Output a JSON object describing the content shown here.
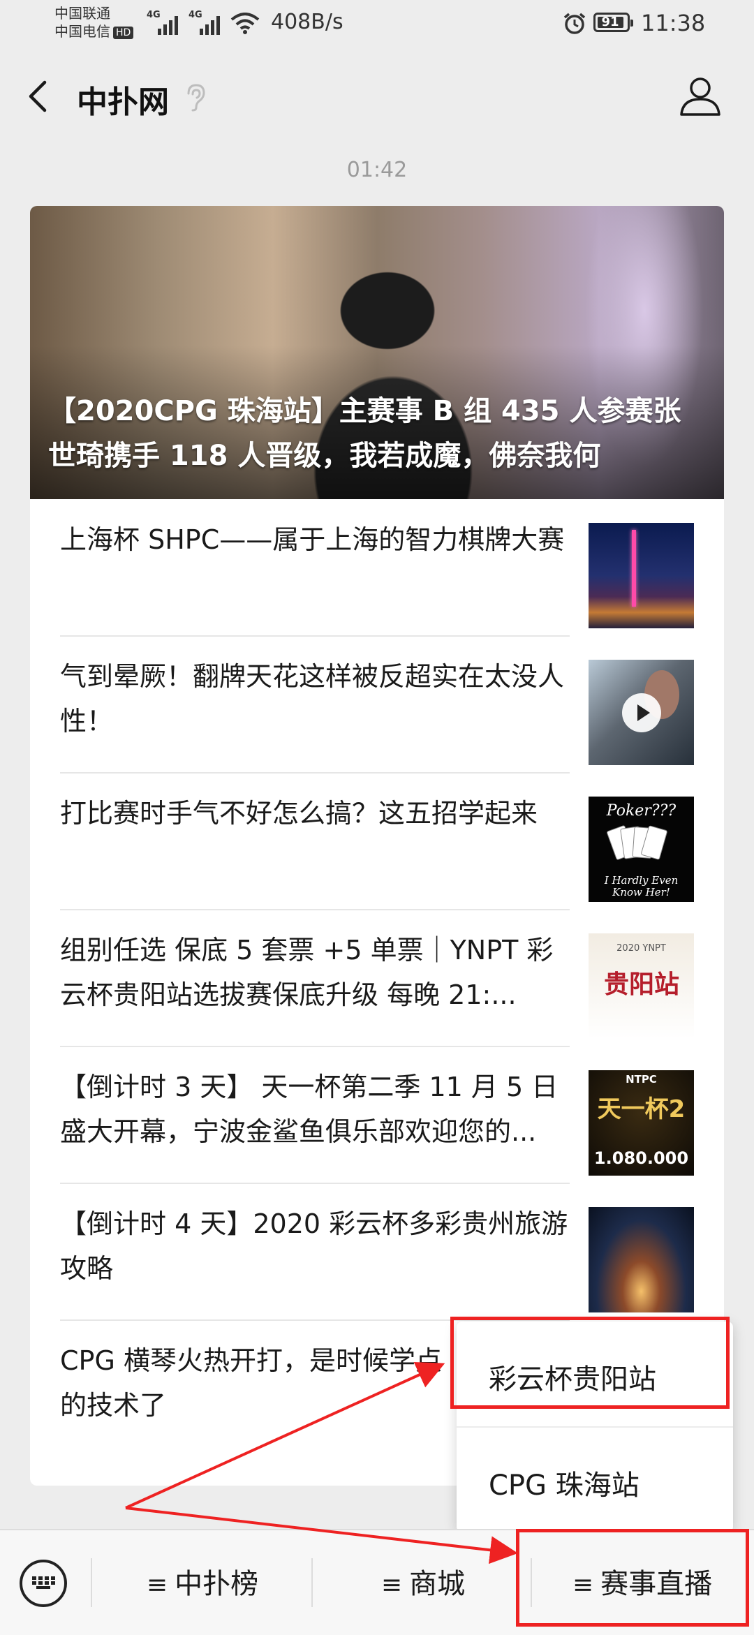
{
  "status_bar": {
    "carrier_1": "中国联通",
    "carrier_2": "中国电信",
    "hd_badge": "HD",
    "net_1": "4G",
    "net_2": "4G",
    "net_speed": "408B/s",
    "battery": "91",
    "time": "11:38"
  },
  "header": {
    "title": "中扑网",
    "icons": {
      "back": "back-arrow-icon",
      "listen": "ear-icon",
      "profile": "person-icon"
    }
  },
  "message_time": "01:42",
  "hero": {
    "title": "【2020CPG 珠海站】主赛事 B 组 435 人参赛张世琦携手 118 人晋级，我若成魔，佛奈我何"
  },
  "articles": [
    {
      "title": "上海杯 SHPC——属于上海的智力棋牌大赛",
      "thumb": "shanghai-night-skyline"
    },
    {
      "title": "气到晕厥！翻牌天花这样被反超实在太没人性！",
      "thumb": "poker-video",
      "has_video": true
    },
    {
      "title": "打比赛时手气不好怎么搞？这五招学起来",
      "thumb": "poker-cards",
      "thumb_text_top": "Poker???",
      "thumb_text_bottom": "I Hardly Even Know Her!"
    },
    {
      "title": "组别任选 保底 5 套票 +5 单票｜YNPT 彩云杯贵阳站选拔赛保底升级 每晚 21:...",
      "thumb": "ynpt-guiyang-poster",
      "thumb_small": "2020 YNPT",
      "thumb_big": "贵阳站"
    },
    {
      "title": "【倒计时 3 天】 天一杯第二季 11 月 5 日盛大开幕，宁波金鲨鱼俱乐部欢迎您的...",
      "thumb": "ntpc-poster",
      "thumb_brand": "NTPC",
      "thumb_big": "天一杯2",
      "thumb_amount": "1.080.000"
    },
    {
      "title": "【倒计时 4 天】2020 彩云杯多彩贵州旅游攻略",
      "thumb": "guizhou-cave"
    },
    {
      "title": "CPG 横琴火热开打，是时候学点",
      "title_line2": "的技术了",
      "thumb": ""
    }
  ],
  "popup_menu": {
    "items": [
      "彩云杯贵阳站",
      "CPG 珠海站"
    ]
  },
  "bottom_menu": {
    "keyboard_icon": "keyboard-icon",
    "items": [
      "中扑榜",
      "商城",
      "赛事直播"
    ],
    "prefix": "≡"
  },
  "annotation": {
    "color": "#ee2222"
  }
}
